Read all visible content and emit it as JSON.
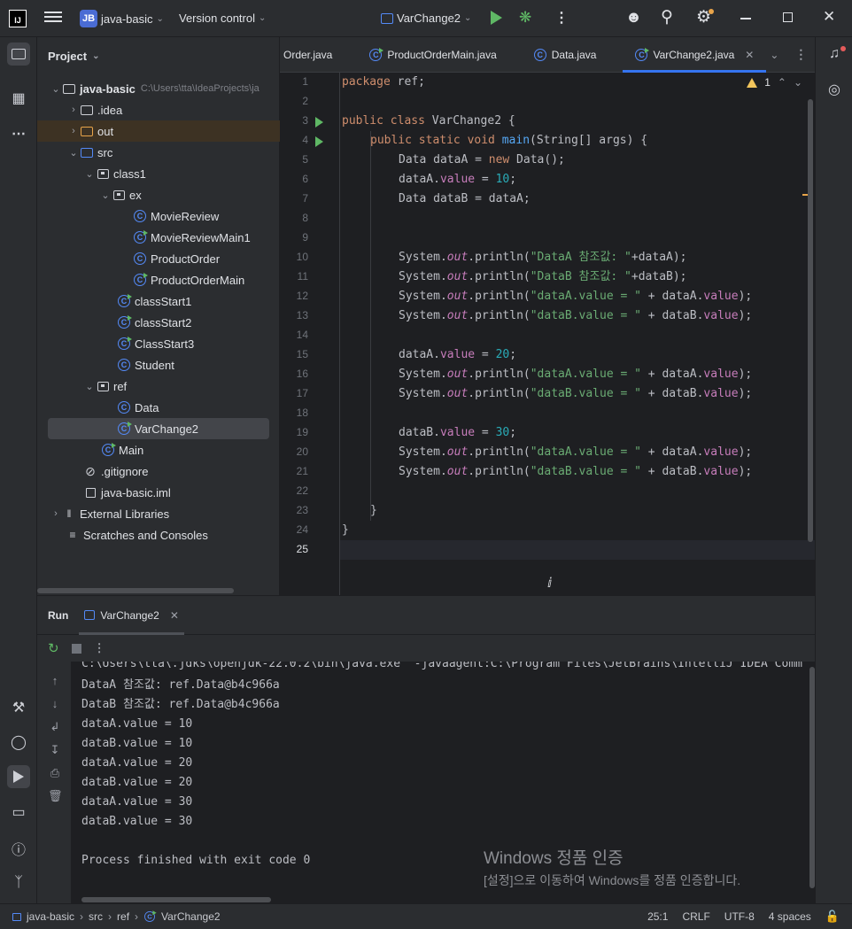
{
  "titlebar": {
    "project_badge": "JB",
    "project_name": "java-basic",
    "vcs": "Version control",
    "run_config": "VarChange2"
  },
  "project_panel": {
    "title": "Project",
    "tree": [
      {
        "label": "java-basic",
        "path": "C:\\Users\\tta\\IdeaProjects\\ja",
        "type": "module"
      },
      {
        "label": ".idea",
        "type": "folder"
      },
      {
        "label": "out",
        "type": "folder-out"
      },
      {
        "label": "src",
        "type": "folder"
      },
      {
        "label": "class1",
        "type": "package"
      },
      {
        "label": "ex",
        "type": "package"
      },
      {
        "label": "MovieReview",
        "type": "class"
      },
      {
        "label": "MovieReviewMain1",
        "type": "class-run"
      },
      {
        "label": "ProductOrder",
        "type": "class"
      },
      {
        "label": "ProductOrderMain",
        "type": "class-run"
      },
      {
        "label": "classStart1",
        "type": "class-run"
      },
      {
        "label": "classStart2",
        "type": "class-run"
      },
      {
        "label": "ClassStart3",
        "type": "class-run"
      },
      {
        "label": "Student",
        "type": "class"
      },
      {
        "label": "ref",
        "type": "package"
      },
      {
        "label": "Data",
        "type": "class"
      },
      {
        "label": "VarChange2",
        "type": "class-run"
      },
      {
        "label": "Main",
        "type": "class-run"
      },
      {
        "label": ".gitignore",
        "type": "file"
      },
      {
        "label": "java-basic.iml",
        "type": "file"
      },
      {
        "label": "External Libraries",
        "type": "lib"
      },
      {
        "label": "Scratches and Consoles",
        "type": "scratch"
      }
    ]
  },
  "editor": {
    "tabs": [
      {
        "label": "Order.java"
      },
      {
        "label": "ProductOrderMain.java"
      },
      {
        "label": "Data.java"
      },
      {
        "label": "VarChange2.java",
        "active": true
      }
    ],
    "warnings": "1",
    "line_numbers": [
      "1",
      "2",
      "3",
      "4",
      "5",
      "6",
      "7",
      "8",
      "9",
      "10",
      "11",
      "12",
      "13",
      "14",
      "15",
      "16",
      "17",
      "18",
      "19",
      "20",
      "21",
      "22",
      "23",
      "24",
      "25"
    ],
    "code": {
      "l1_kw": "package",
      "l1_rest": " ref;",
      "l3_kw": "public class",
      "l3_rest": " VarChange2 {",
      "l4_kw": "public static void",
      "l4_fn": "main",
      "l4_rest": "(String[] args) {",
      "l5_a": "Data dataA = ",
      "l5_kw": "new",
      "l5_b": " Data();",
      "l6_a": "dataA.",
      "l6_f": "value",
      "l6_b": " = ",
      "l6_n": "10",
      "l6_c": ";",
      "l7": "Data dataB = dataA;",
      "sys": "System.",
      "out": "out",
      "println": ".println(",
      "l10_s": "\"DataA 참조값: \"",
      "l10_r": "+dataA);",
      "l11_s": "\"DataB 참조값: \"",
      "l11_r": "+dataB);",
      "sA": "\"dataA.value = \"",
      "sB": "\"dataB.value = \"",
      "plusA": " + dataA.",
      "plusB": " + dataB.",
      "value": "value",
      "end": ");",
      "l15_a": "dataA.",
      "l15_n": "20",
      "l19_a": "dataB.",
      "l19_n": "30",
      "eq": " = ",
      "semi": ";",
      "close_inner": "}",
      "close_outer": "}"
    }
  },
  "run_panel": {
    "title": "Run",
    "tab": "VarChange2",
    "output": [
      "C:\\Users\\tta\\.jdks\\openjdk-22.0.2\\bin\\java.exe \"-javaagent:C:\\Program Files\\JetBrains\\IntelliJ IDEA Comm",
      "DataA 참조값: ref.Data@b4c966a",
      "DataB 참조값: ref.Data@b4c966a",
      "dataA.value = 10",
      "dataB.value = 10",
      "dataA.value = 20",
      "dataB.value = 20",
      "dataA.value = 30",
      "dataB.value = 30",
      "",
      "Process finished with exit code 0"
    ]
  },
  "watermark": {
    "line1": "Windows 정품 인증",
    "line2": "[설정]으로 이동하여 Windows를 정품 인증합니다."
  },
  "statusbar": {
    "crumbs": [
      "java-basic",
      "src",
      "ref",
      "VarChange2"
    ],
    "position": "25:1",
    "line_sep": "CRLF",
    "encoding": "UTF-8",
    "indent": "4 spaces"
  }
}
